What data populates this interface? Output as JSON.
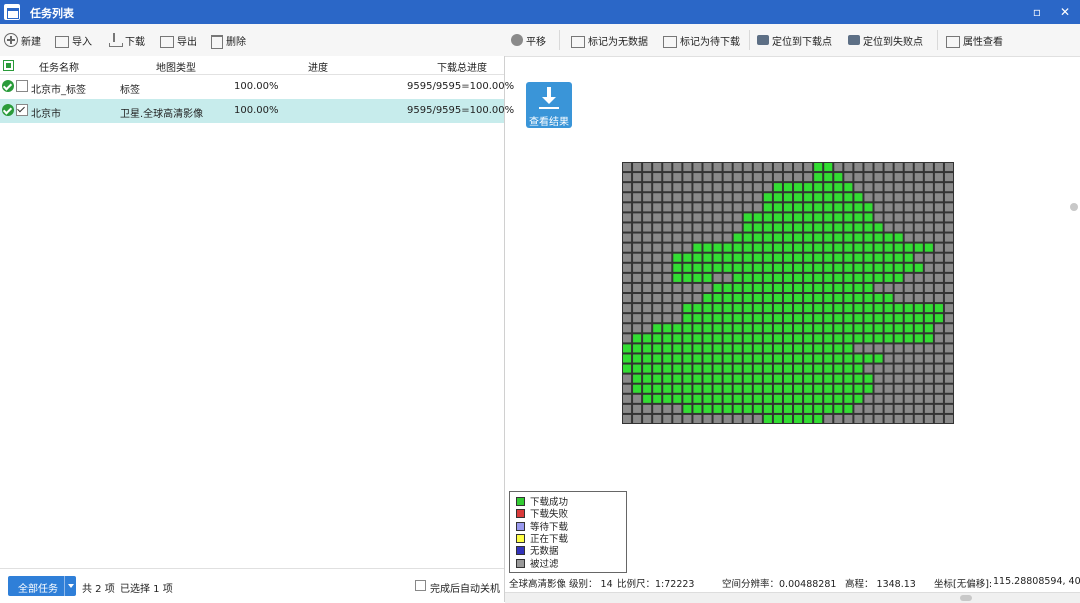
{
  "window": {
    "title": "任务列表",
    "min_label": "▫",
    "close_label": "✕"
  },
  "left_toolbar": {
    "new": "新建",
    "import": "导入",
    "download": "下载",
    "export": "导出",
    "delete": "删除"
  },
  "right_toolbar": {
    "pan": "平移",
    "mark_nodata": "标记为无数据",
    "mark_pending": "标记为待下载",
    "locate_download": "定位到下载点",
    "locate_fail": "定位到失败点",
    "properties": "属性查看"
  },
  "task_list": {
    "columns": [
      "任务名称",
      "地图类型",
      "进度",
      "下载总进度"
    ],
    "rows": [
      {
        "name": "北京市_标签",
        "type": "标签",
        "progress": "100.00%",
        "total": "9595/9595=100.00%",
        "checked": false,
        "selected": false
      },
      {
        "name": "北京市",
        "type": "卫星.全球高清影像",
        "progress": "100.00%",
        "total": "9595/9595=100.00%",
        "checked": true,
        "selected": true
      }
    ]
  },
  "footer_left": {
    "all_tasks": "全部任务",
    "total": "共 2 项",
    "selected": "已选择 1 项",
    "auto_shutdown": "完成后自动关机"
  },
  "view_result": "查看结果",
  "legend": [
    {
      "label": "下载成功",
      "color": "#33cc33"
    },
    {
      "label": "下载失败",
      "color": "#d93a3a"
    },
    {
      "label": "等待下载",
      "color": "#9999ee"
    },
    {
      "label": "正在下载",
      "color": "#ffff44"
    },
    {
      "label": "无数据",
      "color": "#3333bb"
    },
    {
      "label": "被过滤",
      "color": "#999999"
    }
  ],
  "status": {
    "map": "全球高清影像",
    "level": "级别：  14",
    "scale": "比例尺：1:72223",
    "resolution": "空间分辨率：0.00488281",
    "elevation": "高程：   1348.13",
    "coord_label": "坐标[无偏移]:",
    "coord_value": "115.28808594, 40"
  },
  "tile_grid": {
    "cols": 33,
    "rows": 26,
    "success_color": "#33dd33",
    "filtered_color": "#8a8a8a",
    "success_ranges": [
      [
        [
          19,
          20
        ]
      ],
      [
        [
          19,
          21
        ]
      ],
      [
        [
          15,
          22
        ]
      ],
      [
        [
          14,
          23
        ]
      ],
      [
        [
          14,
          24
        ]
      ],
      [
        [
          12,
          24
        ]
      ],
      [
        [
          12,
          25
        ]
      ],
      [
        [
          11,
          27
        ]
      ],
      [
        [
          7,
          30
        ]
      ],
      [
        [
          5,
          28
        ]
      ],
      [
        [
          5,
          29
        ]
      ],
      [
        [
          5,
          8
        ],
        [
          11,
          25
        ],
        [
          26,
          27
        ]
      ],
      [
        [
          9,
          24
        ]
      ],
      [
        [
          8,
          26
        ]
      ],
      [
        [
          6,
          31
        ]
      ],
      [
        [
          6,
          31
        ]
      ],
      [
        [
          3,
          30
        ]
      ],
      [
        [
          1,
          30
        ]
      ],
      [
        [
          0,
          22
        ]
      ],
      [
        [
          0,
          25
        ]
      ],
      [
        [
          0,
          23
        ]
      ],
      [
        [
          1,
          24
        ]
      ],
      [
        [
          1,
          24
        ]
      ],
      [
        [
          2,
          23
        ]
      ],
      [
        [
          6,
          22
        ]
      ],
      [
        [
          14,
          19
        ]
      ]
    ]
  }
}
